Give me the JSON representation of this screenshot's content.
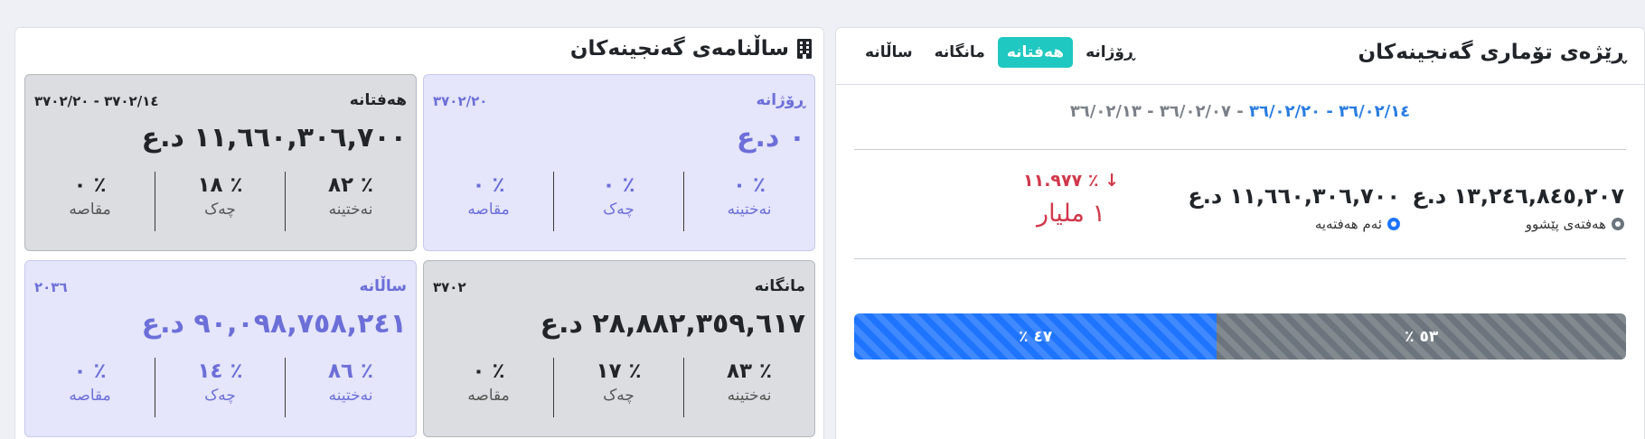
{
  "left": {
    "title": "ساڵنامەی گەنجینەکان",
    "cards": {
      "daily": {
        "label": "ڕۆژانە",
        "date": "٣٧٠٢/٢٠",
        "amount": "٠ د.ع",
        "stats": [
          {
            "pct": "٪ ٠",
            "label": "نەختینە"
          },
          {
            "pct": "٪ ٠",
            "label": "چەک"
          },
          {
            "pct": "٪ ٠",
            "label": "مقاصه"
          }
        ]
      },
      "weekly": {
        "label": "هەفتانە",
        "date": "٣٧٠٢/١٤ - ٣٧٠٢/٢٠",
        "amount": "١١,٦٦٠,٣٠٦,٧٠٠ د.ع",
        "stats": [
          {
            "pct": "٪ ٨٢",
            "label": "نەختینە"
          },
          {
            "pct": "٪ ١٨",
            "label": "چەک"
          },
          {
            "pct": "٪ ٠",
            "label": "مقاصه"
          }
        ]
      },
      "monthly": {
        "label": "مانگانە",
        "date": "٣٧٠٢",
        "amount": "٢٨,٨٨٢,٣٥٩,٦١٧ د.ع",
        "stats": [
          {
            "pct": "٪ ٨٣",
            "label": "نەختینە"
          },
          {
            "pct": "٪ ١٧",
            "label": "چەک"
          },
          {
            "pct": "٪ ٠",
            "label": "مقاصه"
          }
        ]
      },
      "yearly": {
        "label": "ساڵانە",
        "date": "٢٠٣٦",
        "amount": "٩٠,٠٩٨,٧٥٨,٢٤١ د.ع",
        "stats": [
          {
            "pct": "٪ ٨٦",
            "label": "نەختینە"
          },
          {
            "pct": "٪ ١٤",
            "label": "چەک"
          },
          {
            "pct": "٪ ٠",
            "label": "مقاصه"
          }
        ]
      }
    }
  },
  "right": {
    "title": "ڕێژەی تۆماری گەنجینەکان",
    "tabs": [
      {
        "label": "ساڵانە"
      },
      {
        "label": "مانگانە"
      },
      {
        "label": "هەفتانە"
      },
      {
        "label": "ڕۆژانە"
      }
    ],
    "active_tab": "هەفتانە",
    "date_prev": "٣٦/٠٢/٠٧ - ٣٦/٠٢/١٣",
    "date_sep": " - ",
    "date_cur": "٣٦/٠٢/١٤ - ٣٦/٠٢/٢٠",
    "prev": {
      "amount": "١٣,٢٤٦,٨٤٥,٢٠٧ د.ع",
      "legend": "هەفتەی پێشوو"
    },
    "cur": {
      "amount": "١١,٦٦٠,٣٠٦,٧٠٠ د.ع",
      "legend": "ئەم هەفتەیە"
    },
    "change": {
      "arrow": "↓",
      "pct": "٪ ١١.٩٧٧",
      "amount": "١ مليار"
    },
    "progress": {
      "cur": {
        "label": "٪ ٤٧",
        "fraction": 0.47
      },
      "prev": {
        "label": "٪ ٥٣",
        "fraction": 0.53
      }
    },
    "colors": {
      "accent_tab": "#1fc8c0",
      "current": "#1e74ff",
      "previous": "#6c757d",
      "decrease": "#d1394c"
    }
  }
}
